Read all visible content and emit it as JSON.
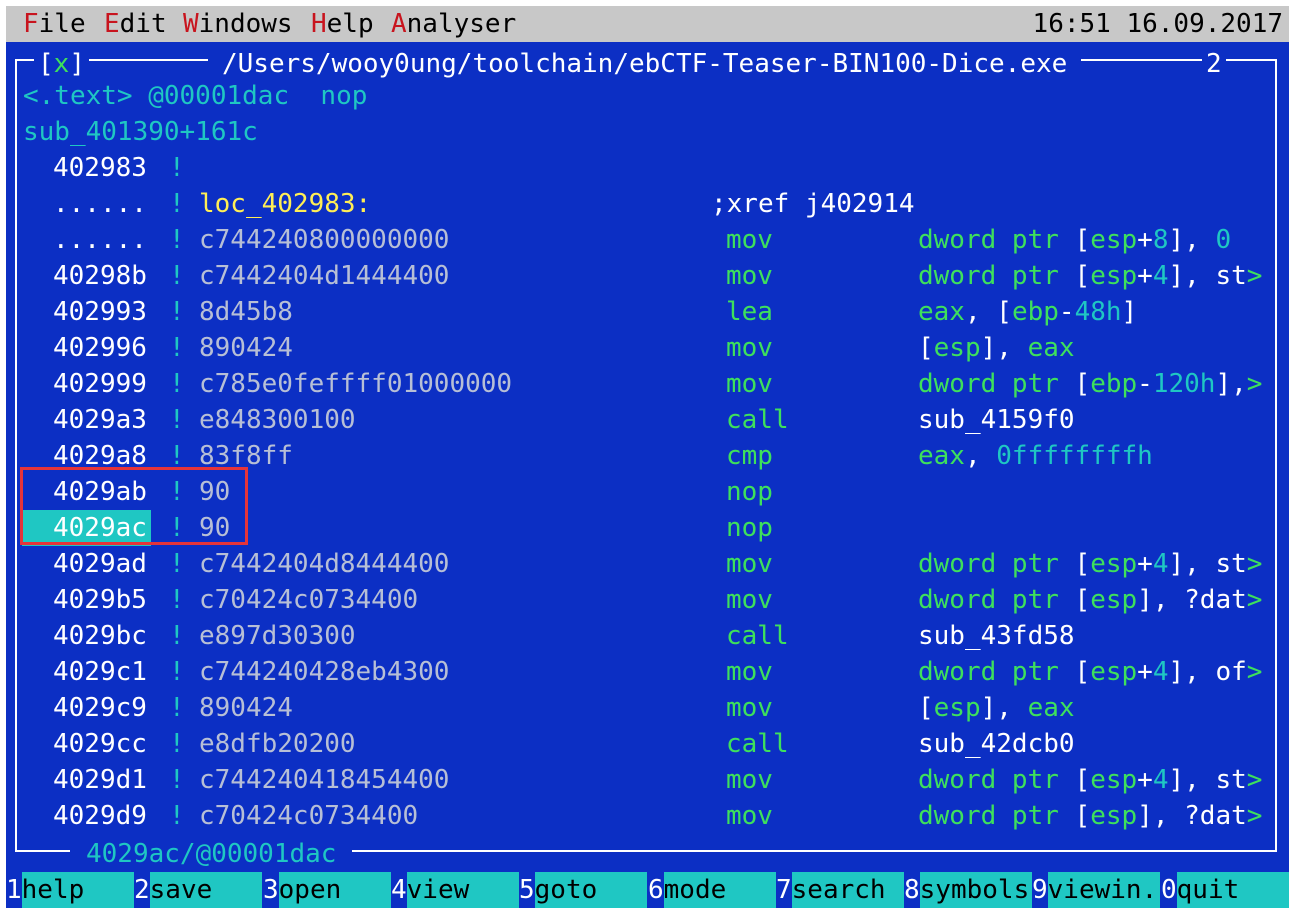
{
  "menubar": {
    "items": [
      {
        "hotkey": "F",
        "rest": "ile"
      },
      {
        "hotkey": "E",
        "rest": "dit"
      },
      {
        "hotkey": "W",
        "rest": "indows"
      },
      {
        "hotkey": "H",
        "rest": "elp"
      },
      {
        "hotkey": "A",
        "rest": "nalyser"
      }
    ],
    "clock": "16:51 16.09.2017"
  },
  "window": {
    "close_left": "[",
    "close_x": "x",
    "close_right": "]",
    "title": "/Users/wooy0ung/toolchain/ebCTF-Teaser-BIN100-Dice.exe",
    "number": "2",
    "header_line1": "<.text> @00001dac  nop",
    "header_line2": "sub_401390+161c",
    "status": "4029ac/@00001dac"
  },
  "rows": [
    {
      "addr": "402983",
      "bytes": "",
      "mnem": "",
      "ops": []
    },
    {
      "addr": "......",
      "label": "loc_402983:",
      "xref_text": ";xref j",
      "xref_target": "402914"
    },
    {
      "addr": "......",
      "bytes": "c744240800000000",
      "mnem": "mov",
      "ops": [
        [
          "g",
          "dword ptr "
        ],
        [
          "w",
          "["
        ],
        [
          "g",
          "esp"
        ],
        [
          "w",
          "+"
        ],
        [
          "c",
          "8"
        ],
        [
          "w",
          "], "
        ],
        [
          "c",
          "0"
        ]
      ]
    },
    {
      "addr": "40298b",
      "bytes": "c7442404d1444400",
      "mnem": "mov",
      "ops": [
        [
          "g",
          "dword ptr "
        ],
        [
          "w",
          "["
        ],
        [
          "g",
          "esp"
        ],
        [
          "w",
          "+"
        ],
        [
          "c",
          "4"
        ],
        [
          "w",
          "], st"
        ],
        [
          "g",
          ">"
        ]
      ]
    },
    {
      "addr": "402993",
      "bytes": "8d45b8",
      "mnem": "lea",
      "ops": [
        [
          "g",
          "eax"
        ],
        [
          "w",
          ", ["
        ],
        [
          "g",
          "ebp"
        ],
        [
          "w",
          "-"
        ],
        [
          "c",
          "48h"
        ],
        [
          "w",
          "]"
        ]
      ]
    },
    {
      "addr": "402996",
      "bytes": "890424",
      "mnem": "mov",
      "ops": [
        [
          "w",
          "["
        ],
        [
          "g",
          "esp"
        ],
        [
          "w",
          "], "
        ],
        [
          "g",
          "eax"
        ]
      ]
    },
    {
      "addr": "402999",
      "bytes": "c785e0feffff01000000",
      "mnem": "mov",
      "ops": [
        [
          "g",
          "dword ptr "
        ],
        [
          "w",
          "["
        ],
        [
          "g",
          "ebp"
        ],
        [
          "w",
          "-"
        ],
        [
          "c",
          "120h"
        ],
        [
          "w",
          "],"
        ],
        [
          "g",
          ">"
        ]
      ]
    },
    {
      "addr": "4029a3",
      "bytes": "e848300100",
      "mnem": "call",
      "ops": [
        [
          "w",
          "sub_4159f0"
        ]
      ]
    },
    {
      "addr": "4029a8",
      "bytes": "83f8ff",
      "mnem": "cmp",
      "ops": [
        [
          "g",
          "eax"
        ],
        [
          "w",
          ", "
        ],
        [
          "c",
          "0ffffffffh"
        ]
      ]
    },
    {
      "addr": "4029ab",
      "bytes": "90",
      "mnem": "nop",
      "ops": []
    },
    {
      "addr": "4029ac",
      "bytes": "90",
      "mnem": "nop",
      "ops": [],
      "current": true
    },
    {
      "addr": "4029ad",
      "bytes": "c7442404d8444400",
      "mnem": "mov",
      "ops": [
        [
          "g",
          "dword ptr "
        ],
        [
          "w",
          "["
        ],
        [
          "g",
          "esp"
        ],
        [
          "w",
          "+"
        ],
        [
          "c",
          "4"
        ],
        [
          "w",
          "], st"
        ],
        [
          "g",
          ">"
        ]
      ]
    },
    {
      "addr": "4029b5",
      "bytes": "c70424c0734400",
      "mnem": "mov",
      "ops": [
        [
          "g",
          "dword ptr "
        ],
        [
          "w",
          "["
        ],
        [
          "g",
          "esp"
        ],
        [
          "w",
          "], ?dat"
        ],
        [
          "g",
          ">"
        ]
      ]
    },
    {
      "addr": "4029bc",
      "bytes": "e897d30300",
      "mnem": "call",
      "ops": [
        [
          "w",
          "sub_43fd58"
        ]
      ]
    },
    {
      "addr": "4029c1",
      "bytes": "c744240428eb4300",
      "mnem": "mov",
      "ops": [
        [
          "g",
          "dword ptr "
        ],
        [
          "w",
          "["
        ],
        [
          "g",
          "esp"
        ],
        [
          "w",
          "+"
        ],
        [
          "c",
          "4"
        ],
        [
          "w",
          "], of"
        ],
        [
          "g",
          ">"
        ]
      ]
    },
    {
      "addr": "4029c9",
      "bytes": "890424",
      "mnem": "mov",
      "ops": [
        [
          "w",
          "["
        ],
        [
          "g",
          "esp"
        ],
        [
          "w",
          "], "
        ],
        [
          "g",
          "eax"
        ]
      ]
    },
    {
      "addr": "4029cc",
      "bytes": "e8dfb20200",
      "mnem": "call",
      "ops": [
        [
          "w",
          "sub_42dcb0"
        ]
      ]
    },
    {
      "addr": "4029d1",
      "bytes": "c744240418454400",
      "mnem": "mov",
      "ops": [
        [
          "g",
          "dword ptr "
        ],
        [
          "w",
          "["
        ],
        [
          "g",
          "esp"
        ],
        [
          "w",
          "+"
        ],
        [
          "c",
          "4"
        ],
        [
          "w",
          "], st"
        ],
        [
          "g",
          ">"
        ]
      ]
    },
    {
      "addr": "4029d9",
      "bytes": "c70424c0734400",
      "mnem": "mov",
      "ops": [
        [
          "g",
          "dword ptr "
        ],
        [
          "w",
          "["
        ],
        [
          "g",
          "esp"
        ],
        [
          "w",
          "], ?dat"
        ],
        [
          "g",
          ">"
        ]
      ]
    }
  ],
  "fkeys": [
    {
      "num": "1",
      "label": "help"
    },
    {
      "num": "2",
      "label": "save"
    },
    {
      "num": "3",
      "label": "open"
    },
    {
      "num": "4",
      "label": "view"
    },
    {
      "num": "5",
      "label": "goto"
    },
    {
      "num": "6",
      "label": "mode"
    },
    {
      "num": "7",
      "label": "search"
    },
    {
      "num": "8",
      "label": "symbols"
    },
    {
      "num": "9",
      "label": "viewin."
    },
    {
      "num": "0",
      "label": "quit"
    }
  ]
}
